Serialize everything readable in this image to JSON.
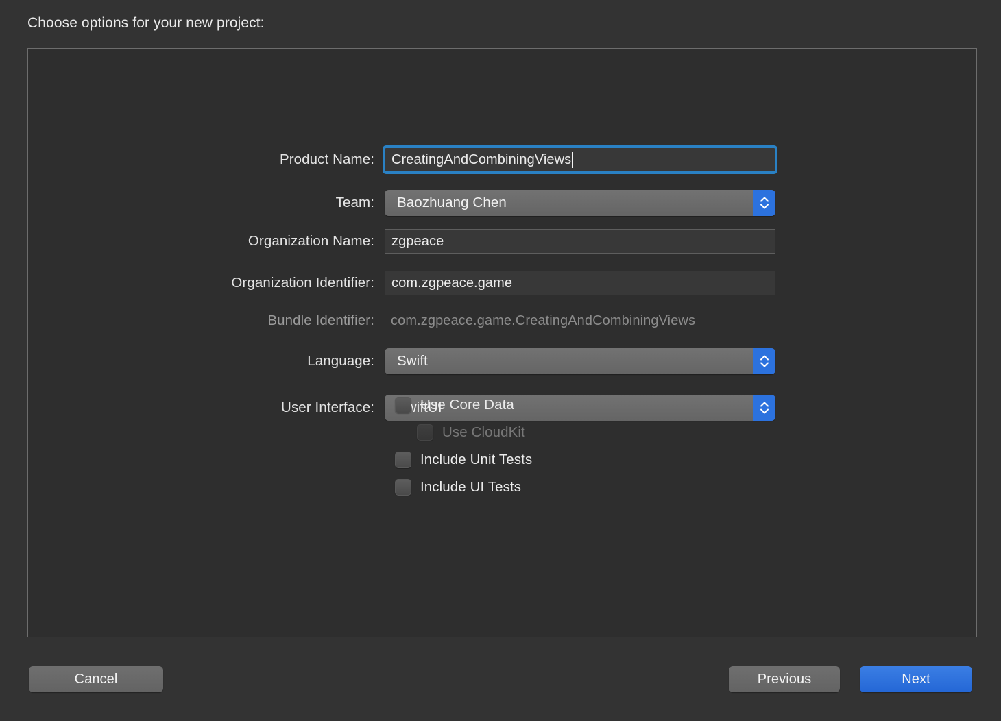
{
  "sheet": {
    "title": "Choose options for your new project:"
  },
  "form": {
    "fields": [
      {
        "label": "Product Name:",
        "kind": "textfield",
        "value": "CreatingAndCombiningViews",
        "focused": true,
        "name": "product-name"
      },
      {
        "label": "Team:",
        "kind": "popup",
        "value": "Baozhuang Chen",
        "name": "team"
      },
      {
        "label": "Organization Name:",
        "kind": "textfield",
        "value": "zgpeace",
        "focused": false,
        "name": "organization-name"
      },
      {
        "label": "Organization Identifier:",
        "kind": "textfield",
        "value": "com.zgpeace.game",
        "focused": false,
        "name": "organization-identifier"
      },
      {
        "label": "Bundle Identifier:",
        "kind": "static",
        "value": "com.zgpeace.game.CreatingAndCombiningViews",
        "name": "bundle-identifier"
      },
      {
        "label": "Language:",
        "kind": "popup",
        "value": "Swift",
        "name": "language"
      },
      {
        "label": "User Interface:",
        "kind": "popup",
        "value": "SwiftUI",
        "name": "user-interface"
      }
    ],
    "checkboxes": [
      {
        "label": "Use Core Data",
        "checked": false,
        "disabled": false,
        "indented": false,
        "name": "use-core-data"
      },
      {
        "label": "Use CloudKit",
        "checked": false,
        "disabled": true,
        "indented": true,
        "name": "use-cloudkit"
      },
      {
        "label": "Include Unit Tests",
        "checked": false,
        "disabled": false,
        "indented": false,
        "name": "include-unit-tests"
      },
      {
        "label": "Include UI Tests",
        "checked": false,
        "disabled": false,
        "indented": false,
        "name": "include-ui-tests"
      }
    ]
  },
  "footer": {
    "cancel_label": "Cancel",
    "previous_label": "Previous",
    "next_label": "Next"
  },
  "icons": {
    "stepper": "chevron-up-down-icon"
  },
  "colors": {
    "window_background": "#333333",
    "panel_background": "#2e2e2e",
    "panel_border": "#6d6d6d",
    "accent_blue": "#2c72de",
    "focus_ring": "#2a81c4",
    "default_button_blue": "#2d72e0",
    "control_gray": "#6a6a6a",
    "text_primary": "#ececec",
    "text_disabled": "#8c8c8c"
  }
}
